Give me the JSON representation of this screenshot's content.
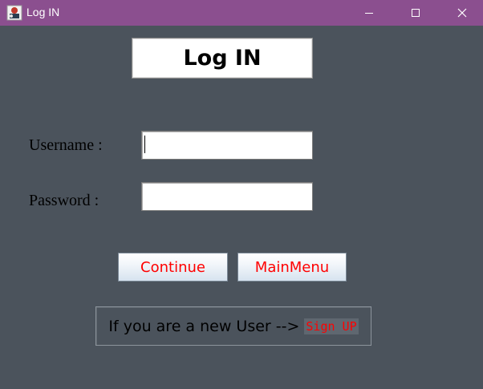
{
  "window": {
    "title": "Log IN",
    "titlebar_color": "#8b4f8f",
    "background_color": "#4b535c",
    "controls": [
      "minimize-icon",
      "maximize-icon",
      "close-icon"
    ]
  },
  "header": {
    "title": "Log IN"
  },
  "form": {
    "username_label": "Username :",
    "username_value": "",
    "password_label": "Password :",
    "password_value": ""
  },
  "buttons": {
    "continue_label": "Continue",
    "mainmenu_label": "MainMenu",
    "label_color": "#ff0000"
  },
  "signup": {
    "prompt": "If you are a new User -->",
    "link_label": "Sign UP"
  }
}
